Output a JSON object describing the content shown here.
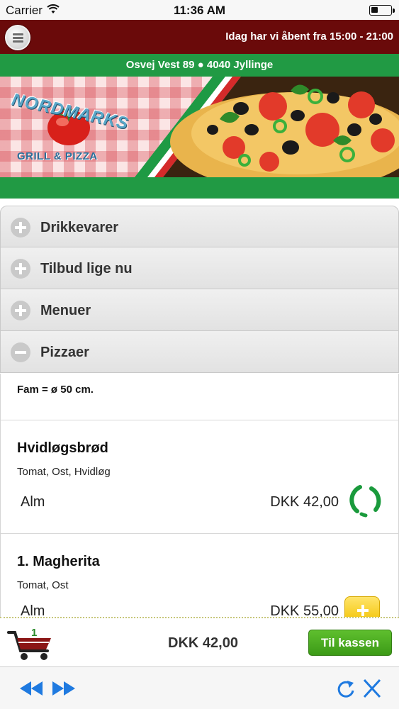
{
  "status_bar": {
    "carrier": "Carrier",
    "time": "11:36 AM"
  },
  "header": {
    "hours": "Idag har vi åbent fra 15:00 - 21:00",
    "address": "Osvej Vest 89 ● 4040 Jyllinge"
  },
  "logo": {
    "name": "NORDMARKS",
    "subtitle": "GRILL & PIZZA"
  },
  "accordion": [
    {
      "label": "Drikkevarer",
      "icon": "plus-circle-icon"
    },
    {
      "label": "Tilbud lige nu",
      "icon": "plus-circle-icon"
    },
    {
      "label": "Menuer",
      "icon": "plus-circle-icon"
    },
    {
      "label": "Pizzaer",
      "icon": "minus-circle-icon"
    }
  ],
  "menu": {
    "note": "Fam = ø 50 cm.",
    "products": [
      {
        "name": "Hvidløgsbrød",
        "description": "Tomat, Ost, Hvidløg",
        "size": "Alm",
        "price": "DKK 42,00",
        "action": "loading-spinner-icon"
      },
      {
        "name": "1. Magherita",
        "description": "Tomat, Ost",
        "size": "Alm",
        "price": "DKK  55,00",
        "action": "add-icon"
      }
    ]
  },
  "cart": {
    "count": "1",
    "total": "DKK 42,00",
    "checkout_label": "Til kassen"
  },
  "colors": {
    "header_bg": "#6a0a0a",
    "green": "#219a44",
    "checkout_green": "#4aa820",
    "add_yellow": "#f5c800",
    "toolbar_blue": "#1f7ae0"
  }
}
